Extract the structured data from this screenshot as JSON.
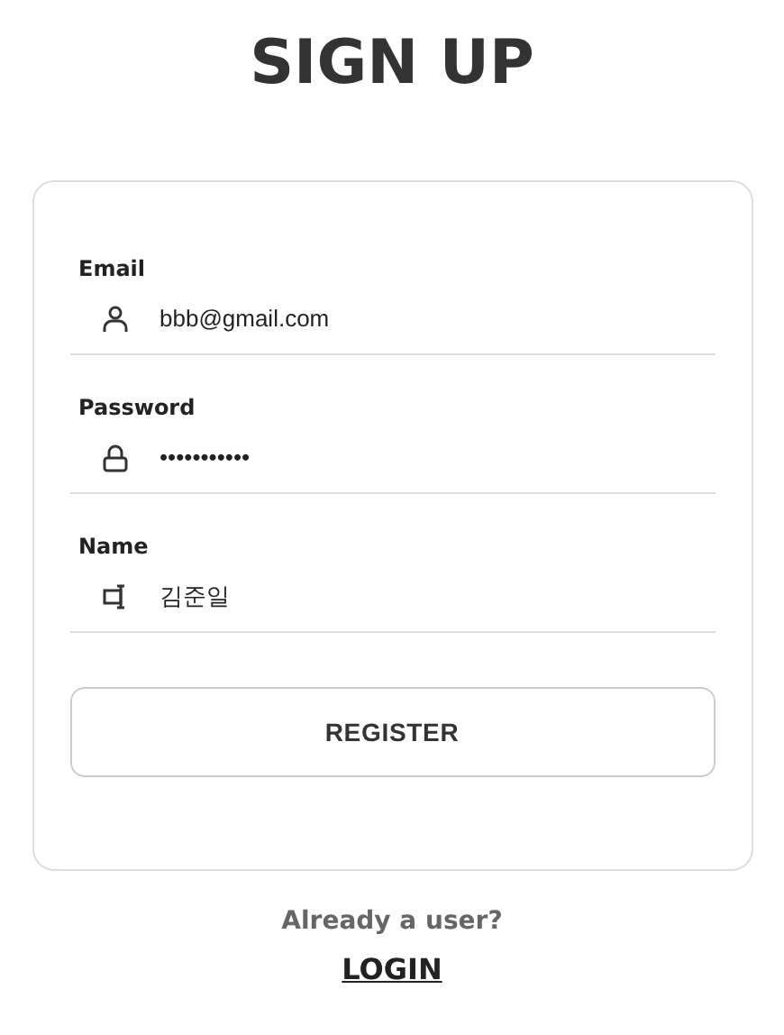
{
  "title": "SIGN UP",
  "fields": [
    {
      "kind": "email",
      "label": "Email",
      "value": "bbb@gmail.com"
    },
    {
      "kind": "password",
      "label": "Password",
      "value": "•••••••••••"
    },
    {
      "kind": "name",
      "label": "Name",
      "value": "김준일"
    }
  ],
  "button": "REGISTER",
  "prompt": "Already a user?",
  "link": "LOGIN"
}
